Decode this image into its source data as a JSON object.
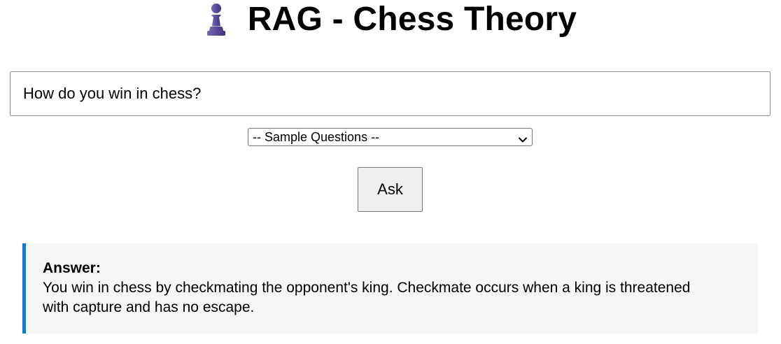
{
  "header": {
    "icon": "chess-pawn-icon",
    "title": "RAG - Chess Theory"
  },
  "question": {
    "value": "How do you win in chess?"
  },
  "samples": {
    "selected": "-- Sample Questions --"
  },
  "ask": {
    "label": "Ask"
  },
  "answer": {
    "heading": "Answer:",
    "text": "You win in chess by checkmating the opponent's king. Checkmate occurs when a king is threatened with capture and has no escape."
  },
  "colors": {
    "accent": "#0a7fd6",
    "pawn": "#5b4b9a",
    "answer_bg": "#f6f6f6"
  }
}
